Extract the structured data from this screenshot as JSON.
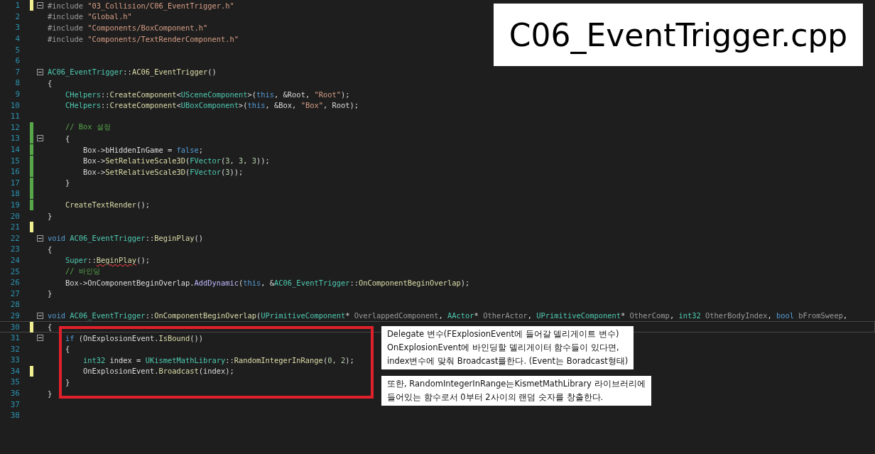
{
  "title": "C06_EventTrigger.cpp",
  "lines": [
    {
      "number": "1",
      "color": "#efef91",
      "fold": true,
      "current": false,
      "tokens": [
        {
          "text": "#include ",
          "kind": "pp"
        },
        {
          "text": "\"03_Collision/C06_EventTrigger.h\"",
          "kind": "str"
        }
      ]
    },
    {
      "number": "2",
      "fold": false,
      "current": false,
      "tokens": [
        {
          "text": "#include ",
          "kind": "pp"
        },
        {
          "text": "\"Global.h\"",
          "kind": "str"
        }
      ]
    },
    {
      "number": "3",
      "fold": false,
      "current": false,
      "tokens": [
        {
          "text": "#include ",
          "kind": "pp"
        },
        {
          "text": "\"Components/BoxComponent.h\"",
          "kind": "str"
        }
      ]
    },
    {
      "number": "4",
      "fold": false,
      "current": false,
      "tokens": [
        {
          "text": "#include ",
          "kind": "pp"
        },
        {
          "text": "\"Components/TextRenderComponent.h\"",
          "kind": "str"
        }
      ]
    },
    {
      "number": "5",
      "fold": false,
      "current": false
    },
    {
      "number": "6",
      "fold": false,
      "current": false
    },
    {
      "number": "7",
      "fold": true,
      "current": false,
      "tokens": [
        {
          "text": "AC06_EventTrigger",
          "kind": "type"
        },
        {
          "text": "::",
          "kind": "plain"
        },
        {
          "text": "AC06_EventTrigger",
          "kind": "func"
        },
        {
          "text": "()",
          "kind": "plain"
        }
      ]
    },
    {
      "number": "8",
      "fold": false,
      "current": false,
      "tokens": [
        {
          "text": "{",
          "kind": "plain"
        }
      ]
    },
    {
      "number": "9",
      "fold": false,
      "current": false,
      "tokens": [
        {
          "text": "    CHelpers",
          "kind": "type"
        },
        {
          "text": "::",
          "kind": "plain"
        },
        {
          "text": "CreateComponent",
          "kind": "func"
        },
        {
          "text": "<",
          "kind": "plain"
        },
        {
          "text": "USceneComponent",
          "kind": "type"
        },
        {
          "text": ">(",
          "kind": "plain"
        },
        {
          "text": "this",
          "kind": "kw"
        },
        {
          "text": ", &Root, ",
          "kind": "plain"
        },
        {
          "text": "\"Root\"",
          "kind": "str"
        },
        {
          "text": ");",
          "kind": "plain"
        }
      ]
    },
    {
      "number": "10",
      "fold": false,
      "current": false,
      "tokens": [
        {
          "text": "    CHelpers",
          "kind": "type"
        },
        {
          "text": "::",
          "kind": "plain"
        },
        {
          "text": "CreateComponent",
          "kind": "func"
        },
        {
          "text": "<",
          "kind": "plain"
        },
        {
          "text": "UBoxComponent",
          "kind": "type"
        },
        {
          "text": ">(",
          "kind": "plain"
        },
        {
          "text": "this",
          "kind": "kw"
        },
        {
          "text": ", &Box, ",
          "kind": "plain"
        },
        {
          "text": "\"Box\"",
          "kind": "str"
        },
        {
          "text": ", Root);",
          "kind": "plain"
        }
      ]
    },
    {
      "number": "11",
      "fold": false,
      "current": false
    },
    {
      "number": "12",
      "color": "#57a64a",
      "fold": false,
      "current": false,
      "tokens": [
        {
          "text": "    // Box 설정",
          "kind": "cm"
        }
      ]
    },
    {
      "number": "13",
      "color": "#57a64a",
      "fold": true,
      "current": false,
      "tokens": [
        {
          "text": "    {",
          "kind": "plain"
        }
      ]
    },
    {
      "number": "14",
      "color": "#57a64a",
      "fold": false,
      "current": false,
      "tokens": [
        {
          "text": "        Box->bHiddenInGame = ",
          "kind": "plain"
        },
        {
          "text": "false",
          "kind": "kw"
        },
        {
          "text": ";",
          "kind": "plain"
        }
      ]
    },
    {
      "number": "15",
      "color": "#57a64a",
      "fold": false,
      "current": false,
      "tokens": [
        {
          "text": "        Box->",
          "kind": "plain"
        },
        {
          "text": "SetRelativeScale3D",
          "kind": "func"
        },
        {
          "text": "(",
          "kind": "plain"
        },
        {
          "text": "FVector",
          "kind": "type"
        },
        {
          "text": "(",
          "kind": "plain"
        },
        {
          "text": "3, 3, 3",
          "kind": "num"
        },
        {
          "text": "));",
          "kind": "plain"
        }
      ]
    },
    {
      "number": "16",
      "color": "#57a64a",
      "fold": false,
      "current": false,
      "tokens": [
        {
          "text": "        Box->",
          "kind": "plain"
        },
        {
          "text": "SetRelativeScale3D",
          "kind": "func"
        },
        {
          "text": "(",
          "kind": "plain"
        },
        {
          "text": "FVector",
          "kind": "type"
        },
        {
          "text": "(",
          "kind": "plain"
        },
        {
          "text": "3",
          "kind": "num"
        },
        {
          "text": "));",
          "kind": "plain"
        }
      ]
    },
    {
      "number": "17",
      "color": "#57a64a",
      "fold": false,
      "current": false,
      "tokens": [
        {
          "text": "    }",
          "kind": "plain"
        }
      ]
    },
    {
      "number": "18",
      "color": "#57a64a",
      "fold": false,
      "current": false
    },
    {
      "number": "19",
      "color": "#57a64a",
      "fold": false,
      "current": false,
      "tokens": [
        {
          "text": "    CreateTextRender",
          "kind": "func"
        },
        {
          "text": "();",
          "kind": "plain"
        }
      ]
    },
    {
      "number": "20",
      "fold": false,
      "current": false,
      "tokens": [
        {
          "text": "}",
          "kind": "plain"
        }
      ]
    },
    {
      "number": "21",
      "color": "#efef91",
      "fold": false,
      "current": false
    },
    {
      "number": "22",
      "fold": true,
      "current": false,
      "tokens": [
        {
          "text": "void ",
          "kind": "kw"
        },
        {
          "text": "AC06_EventTrigger",
          "kind": "type"
        },
        {
          "text": "::",
          "kind": "plain"
        },
        {
          "text": "BeginPlay",
          "kind": "func"
        },
        {
          "text": "()",
          "kind": "plain"
        }
      ]
    },
    {
      "number": "23",
      "fold": false,
      "current": false,
      "tokens": [
        {
          "text": "{",
          "kind": "plain"
        }
      ]
    },
    {
      "number": "24",
      "fold": false,
      "current": false,
      "tokens": [
        {
          "text": "    Super",
          "kind": "type"
        },
        {
          "text": "::",
          "kind": "plain"
        },
        {
          "text": "BeginPlay",
          "kind": "err"
        },
        {
          "text": "();",
          "kind": "plain"
        }
      ]
    },
    {
      "number": "25",
      "fold": false,
      "current": false,
      "tokens": [
        {
          "text": "    // 바인딩",
          "kind": "cm"
        }
      ]
    },
    {
      "number": "26",
      "fold": false,
      "current": false,
      "tokens": [
        {
          "text": "    Box->OnComponentBeginOverlap.",
          "kind": "plain"
        },
        {
          "text": "AddDynamic",
          "kind": "macro"
        },
        {
          "text": "(",
          "kind": "plain"
        },
        {
          "text": "this",
          "kind": "kw"
        },
        {
          "text": ", &",
          "kind": "plain"
        },
        {
          "text": "AC06_EventTrigger",
          "kind": "type"
        },
        {
          "text": "::",
          "kind": "plain"
        },
        {
          "text": "OnComponentBeginOverlap",
          "kind": "func"
        },
        {
          "text": ");",
          "kind": "plain"
        }
      ]
    },
    {
      "number": "27",
      "fold": false,
      "current": false,
      "tokens": [
        {
          "text": "}",
          "kind": "plain"
        }
      ]
    },
    {
      "number": "28",
      "fold": false,
      "current": false
    },
    {
      "number": "29",
      "fold": true,
      "current": false,
      "tokens": [
        {
          "text": "void ",
          "kind": "kw"
        },
        {
          "text": "AC06_EventTrigger",
          "kind": "type"
        },
        {
          "text": "::",
          "kind": "plain"
        },
        {
          "text": "OnComponentBeginOverlap",
          "kind": "func"
        },
        {
          "text": "(",
          "kind": "plain"
        },
        {
          "text": "UPrimitiveComponent",
          "kind": "type"
        },
        {
          "text": "* ",
          "kind": "plain"
        },
        {
          "text": "OverlappedComponent",
          "kind": "param"
        },
        {
          "text": ", ",
          "kind": "plain"
        },
        {
          "text": "AActor",
          "kind": "type"
        },
        {
          "text": "* ",
          "kind": "plain"
        },
        {
          "text": "OtherActor",
          "kind": "param"
        },
        {
          "text": ", ",
          "kind": "plain"
        },
        {
          "text": "UPrimitiveComponent",
          "kind": "type"
        },
        {
          "text": "* ",
          "kind": "plain"
        },
        {
          "text": "OtherComp",
          "kind": "param"
        },
        {
          "text": ", ",
          "kind": "plain"
        },
        {
          "text": "int32",
          "kind": "type"
        },
        {
          "text": " OtherBodyIndex",
          "kind": "param"
        },
        {
          "text": ", ",
          "kind": "plain"
        },
        {
          "text": "bool",
          "kind": "kw"
        },
        {
          "text": " bFromSweep",
          "kind": "param"
        },
        {
          "text": ",",
          "kind": "plain"
        }
      ]
    },
    {
      "number": "30",
      "color": "#efef91",
      "fold": false,
      "current": true,
      "tokens": [
        {
          "text": "{",
          "kind": "plain"
        }
      ]
    },
    {
      "number": "31",
      "fold": true,
      "current": false,
      "tokens": [
        {
          "text": "    if",
          "kind": "kw"
        },
        {
          "text": " (OnExplosionEvent.",
          "kind": "plain"
        },
        {
          "text": "IsBound",
          "kind": "func"
        },
        {
          "text": "())",
          "kind": "plain"
        }
      ]
    },
    {
      "number": "32",
      "fold": false,
      "current": false,
      "tokens": [
        {
          "text": "    {",
          "kind": "plain"
        }
      ]
    },
    {
      "number": "33",
      "fold": false,
      "current": false,
      "tokens": [
        {
          "text": "        int32",
          "kind": "type"
        },
        {
          "text": " index = ",
          "kind": "plain"
        },
        {
          "text": "UKismetMathLibrary",
          "kind": "type"
        },
        {
          "text": "::",
          "kind": "plain"
        },
        {
          "text": "RandomIntegerInRange",
          "kind": "func"
        },
        {
          "text": "(",
          "kind": "plain"
        },
        {
          "text": "0, 2",
          "kind": "num"
        },
        {
          "text": ");",
          "kind": "plain"
        }
      ]
    },
    {
      "number": "34",
      "color": "#efef91",
      "fold": false,
      "current": false,
      "tokens": [
        {
          "text": "        OnExplosionEvent.",
          "kind": "plain"
        },
        {
          "text": "Broadcast",
          "kind": "func"
        },
        {
          "text": "(index);",
          "kind": "plain"
        }
      ]
    },
    {
      "number": "35",
      "fold": false,
      "current": false,
      "tokens": [
        {
          "text": "    }",
          "kind": "plain"
        }
      ]
    },
    {
      "number": "36",
      "fold": false,
      "current": false,
      "tokens": [
        {
          "text": "}",
          "kind": "plain"
        }
      ]
    },
    {
      "number": "37",
      "fold": false,
      "current": false
    },
    {
      "number": "38",
      "fold": false,
      "current": false
    }
  ],
  "annotations": [
    {
      "lines": [
        "Delegate 변수(FExplosionEvent에 들어갈 델리게이트 변수)",
        "OnExplosionEvent에 바인딩할 델리게이터 함수들이 있다면,",
        "index변수에 맞춰 Broadcast를한다. (Event는 Boradcast형태)"
      ]
    },
    {
      "lines": [
        "또한, RandomIntegerInRange는KismetMathLibrary 라이브러리에",
        "들어있는 함수로서 0부터 2사이의 랜덤 숫자를 창출한다."
      ]
    }
  ]
}
